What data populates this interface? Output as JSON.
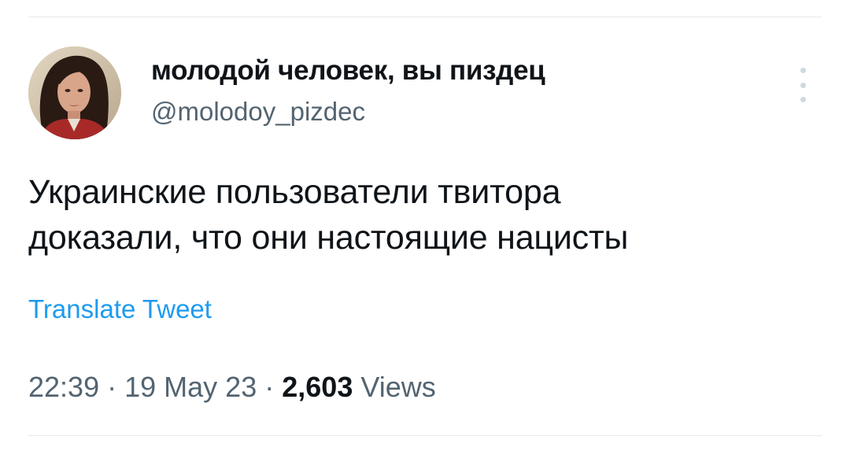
{
  "user": {
    "display_name": "молодой человек, вы пиздец",
    "handle": "@molodoy_pizdec"
  },
  "tweet": {
    "text": "Украинские пользователи твитора\nдоказали, что они настоящие нацисты",
    "translate_label": "Translate Tweet"
  },
  "meta": {
    "time": "22:39",
    "separator": "·",
    "date": "19 May 23",
    "views_count": "2,603",
    "views_label": "Views"
  },
  "icons": {
    "more": "more-vertical-icon"
  },
  "colors": {
    "link": "#1d9bf0",
    "secondary_text": "#536471",
    "primary_text": "#0f1419",
    "divider": "#e6e9ec"
  }
}
